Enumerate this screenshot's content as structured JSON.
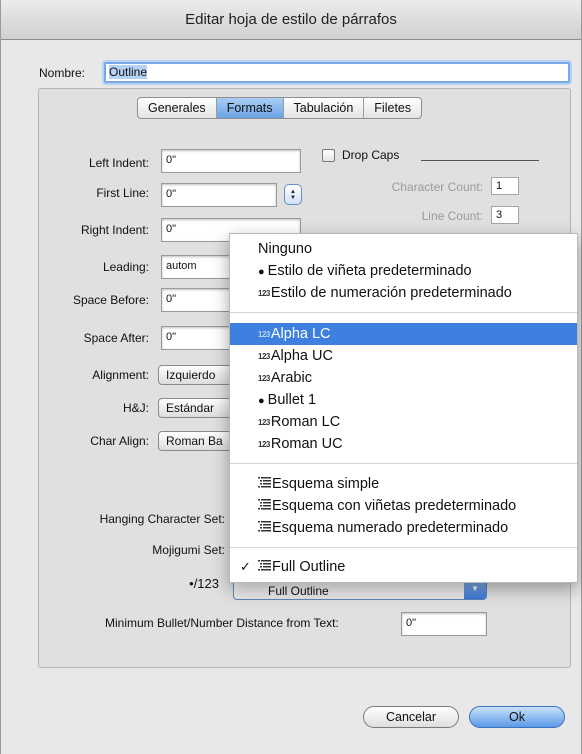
{
  "window": {
    "title": "Editar hoja de estilo de párrafos"
  },
  "name": {
    "label": "Nombre:",
    "value": "Outline"
  },
  "tabs": [
    "Generales",
    "Formats",
    "Tabulación",
    "Filetes"
  ],
  "form": {
    "left_indent": {
      "label": "Left Indent:",
      "value": "0\""
    },
    "first_line": {
      "label": "First Line:",
      "value": "0\""
    },
    "right_indent": {
      "label": "Right Indent:",
      "value": "0\""
    },
    "leading": {
      "label": "Leading:",
      "value": "autom"
    },
    "space_before": {
      "label": "Space Before:",
      "value": "0\""
    },
    "space_after": {
      "label": "Space After:",
      "value": "0\""
    },
    "alignment": {
      "label": "Alignment:",
      "value": "Izquierdo"
    },
    "hj": {
      "label": "H&J:",
      "value": "Estándar"
    },
    "char_align": {
      "label": "Char Align:",
      "value": "Roman Ba"
    },
    "hanging_set": {
      "label": "Hanging Character Set:"
    },
    "mojigumi_set": {
      "label": "Mojigumi Set:"
    },
    "bullet_num": {
      "label": "•/123",
      "value": "Full Outline"
    },
    "min_distance": {
      "label": "Minimum Bullet/Number Distance from Text:",
      "value": "0\""
    }
  },
  "drop_caps": {
    "label": "Drop Caps",
    "checked": false,
    "char_count": {
      "label": "Character Count:",
      "value": "1"
    },
    "line_count": {
      "label": "Line Count:",
      "value": "3"
    }
  },
  "menu": {
    "group1": [
      {
        "icon": "none",
        "label": "Ninguno"
      },
      {
        "icon": "bullet",
        "label": "Estilo de viñeta predeterminado"
      },
      {
        "icon": "number",
        "label": "Estilo de numeración predeterminado"
      }
    ],
    "group2": [
      {
        "icon": "number",
        "label": "Alpha LC",
        "highlighted": true
      },
      {
        "icon": "number",
        "label": "Alpha UC"
      },
      {
        "icon": "number",
        "label": "Arabic"
      },
      {
        "icon": "bullet",
        "label": "Bullet 1"
      },
      {
        "icon": "number",
        "label": "Roman LC"
      },
      {
        "icon": "number",
        "label": "Roman UC"
      }
    ],
    "group3": [
      {
        "icon": "outline",
        "label": "Esquema simple"
      },
      {
        "icon": "outline",
        "label": "Esquema con viñetas predeterminado"
      },
      {
        "icon": "outline",
        "label": "Esquema numerado predeterminado"
      }
    ],
    "group4": [
      {
        "icon": "outline",
        "label": "Full Outline",
        "checked": true
      }
    ],
    "number_icon_text": "123",
    "bullet_icon_text": "●",
    "check_mark": "✓"
  },
  "buttons": {
    "cancel": "Cancelar",
    "ok": "Ok"
  },
  "colors": {
    "selection": "#3d80df",
    "focus_ring": "#7aa7e6"
  }
}
